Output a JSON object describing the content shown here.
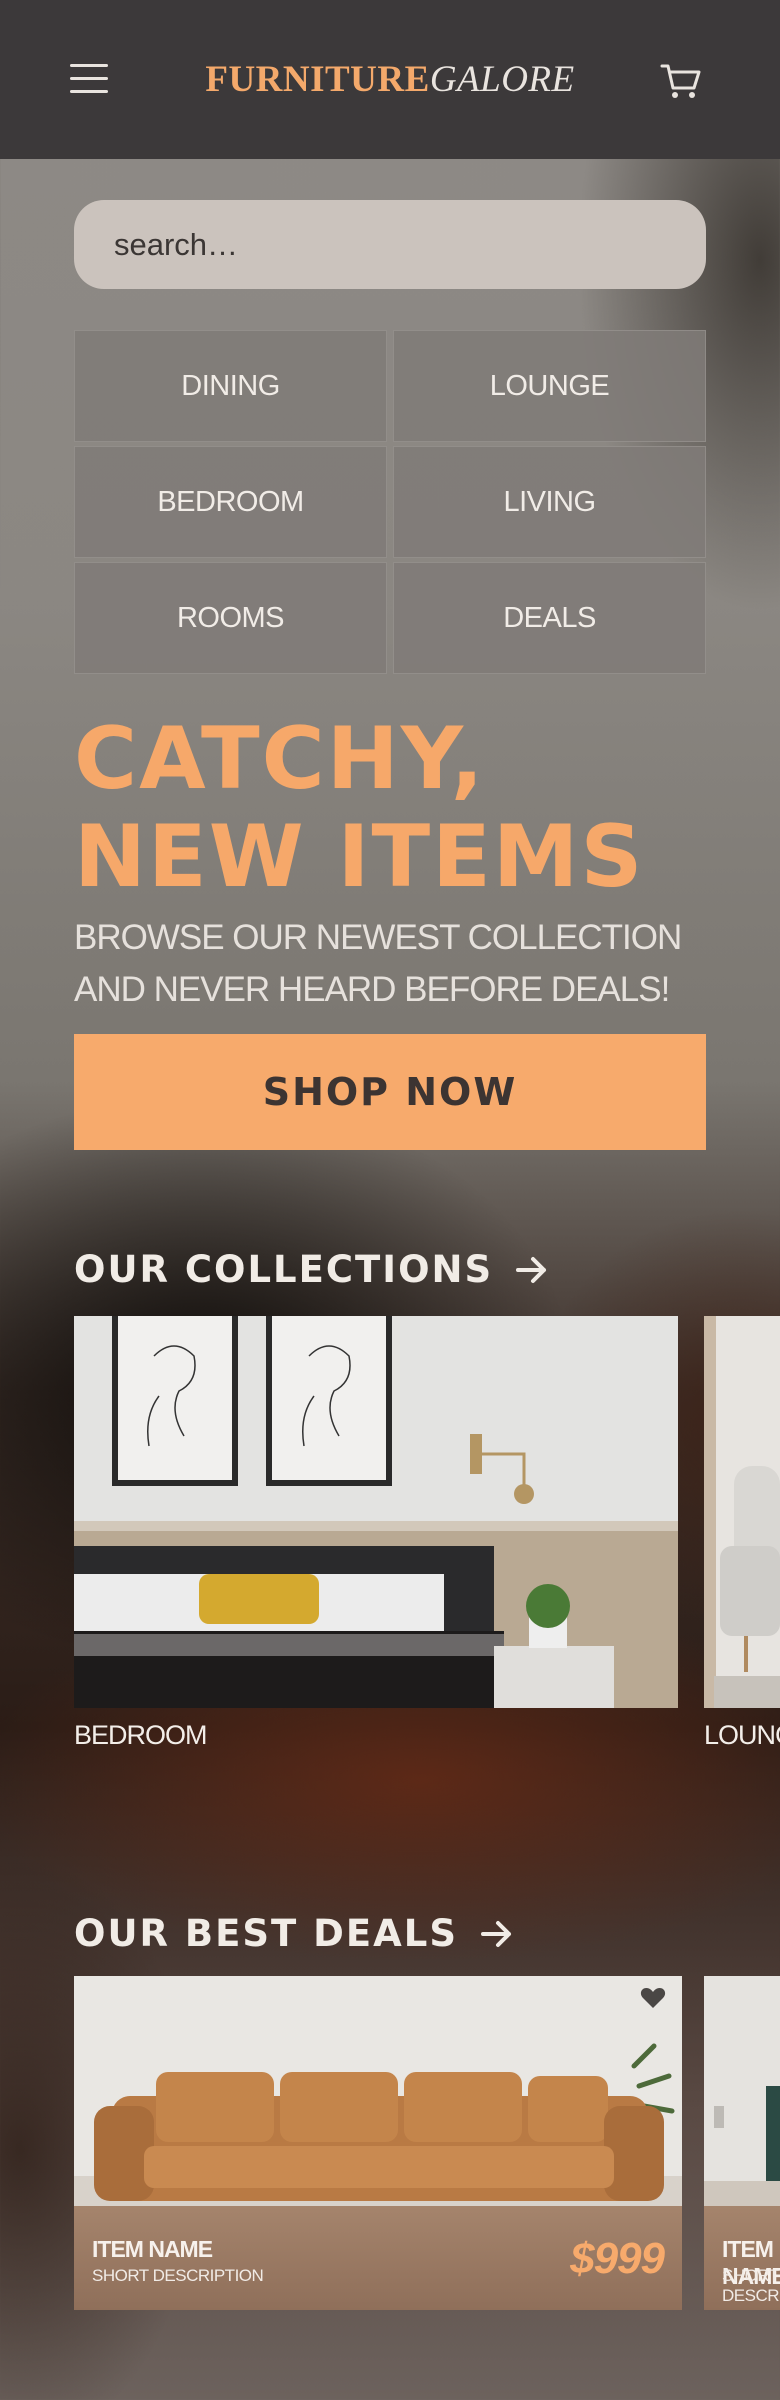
{
  "header": {
    "brand_part1": "FURNITURE",
    "brand_part2": "GALORE",
    "menu_icon": "hamburger-menu-icon",
    "cart_icon": "shopping-cart-icon"
  },
  "search": {
    "placeholder": "search…"
  },
  "categories": [
    "DINING",
    "LOUNGE",
    "BEDROOM",
    "LIVING",
    "ROOMS",
    "DEALS"
  ],
  "hero": {
    "title_line1": "CATCHY,",
    "title_line2": "NEW ITEMS",
    "subtitle_line1": "BROWSE OUR NEWEST COLLECTION",
    "subtitle_line2": "AND NEVER HEARD BEFORE DEALS!",
    "cta_label": "SHOP NOW"
  },
  "collections": {
    "title": "OUR COLLECTIONS",
    "items": [
      {
        "label": "BEDROOM"
      },
      {
        "label": "LOUNGE"
      }
    ]
  },
  "deals": {
    "title": "OUR BEST DEALS",
    "items": [
      {
        "name": "ITEM NAME",
        "description": "SHORT DESCRIPTION",
        "price": "$999"
      },
      {
        "name": "ITEM NAME",
        "description": "SHORT DESCRIPTION",
        "price": ""
      }
    ]
  },
  "colors": {
    "accent": "#f7aa6c",
    "header_bg": "#3c393a"
  }
}
